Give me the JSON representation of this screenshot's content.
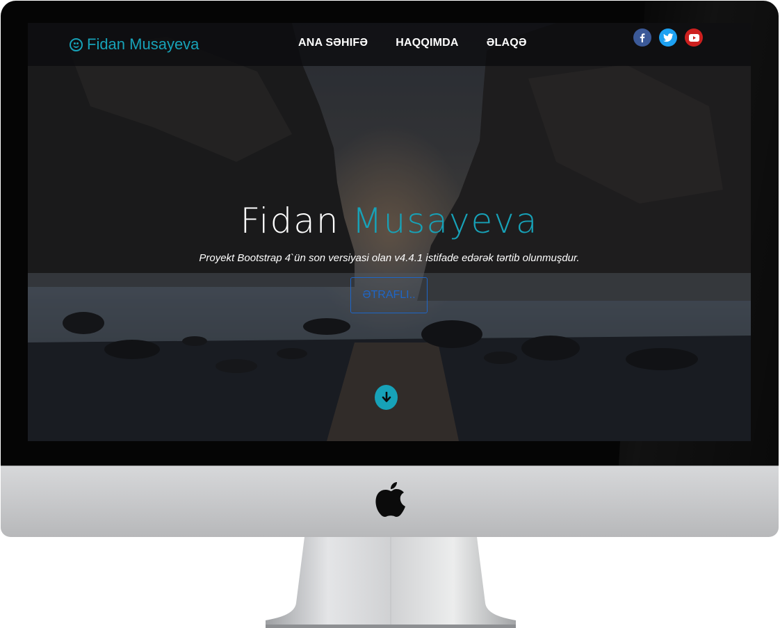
{
  "navbar": {
    "brand_text": "Fidan Musayeva",
    "brand_icon": "smile-icon",
    "links": [
      {
        "label": "ANA SƏHIFƏ"
      },
      {
        "label": "HAQQIMDA"
      },
      {
        "label": "ƏLAQƏ"
      }
    ],
    "socials": [
      {
        "icon": "facebook-icon",
        "color": "#3b5998"
      },
      {
        "icon": "twitter-icon",
        "color": "#1da1f2"
      },
      {
        "icon": "youtube-icon",
        "color": "#cd201f"
      }
    ]
  },
  "hero": {
    "title_first": "Fidan",
    "title_second": "Musayeva",
    "subtitle": "Proyekt Bootstrap 4`ün son versiyasi olan v4.4.1 istifade edərək tərtib olunmuşdur.",
    "button_label": "ƏTRAFLI..",
    "scroll_icon": "arrow-down-icon"
  },
  "colors": {
    "accent": "#17a2b8",
    "button_border": "#1e66c8"
  },
  "device": {
    "logo": "apple-logo"
  }
}
